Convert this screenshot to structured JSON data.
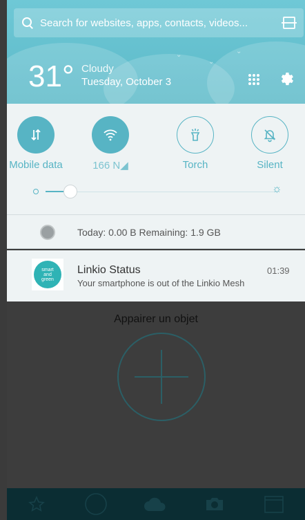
{
  "search": {
    "placeholder": "Search for websites, apps, contacts, videos..."
  },
  "weather": {
    "temperature": "31°",
    "condition": "Cloudy",
    "date": "Tuesday, October 3"
  },
  "quick_settings": {
    "tiles": [
      {
        "label": "Mobile data",
        "state": "on",
        "icon": "mobile-data-icon"
      },
      {
        "label": "Wi-Fi network name",
        "visible_text": "166   N◢",
        "state": "on",
        "icon": "wifi-icon"
      },
      {
        "label": "Torch",
        "state": "off",
        "icon": "torch-icon"
      },
      {
        "label": "Silent",
        "state": "off",
        "icon": "silent-bell-icon"
      }
    ],
    "brightness_level": 0.11
  },
  "data_usage": {
    "text": "Today: 0.00 B   Remaining: 1.9 GB"
  },
  "notification": {
    "app_icon_text": "smart and green",
    "title": "Linkio Status",
    "message": "Your smartphone is out of the Linkio Mesh",
    "time": "01:39"
  },
  "background_app": {
    "title": "Appairer un objet"
  },
  "bottom_nav": {
    "items": [
      "star-icon",
      "circle-icon",
      "cloud-icon",
      "camera-icon",
      "calendar-icon"
    ]
  },
  "colors": {
    "accent": "#57b4c4",
    "header": "#5bb9c8",
    "panel": "#eef3f4",
    "nav": "#0b2d33"
  }
}
